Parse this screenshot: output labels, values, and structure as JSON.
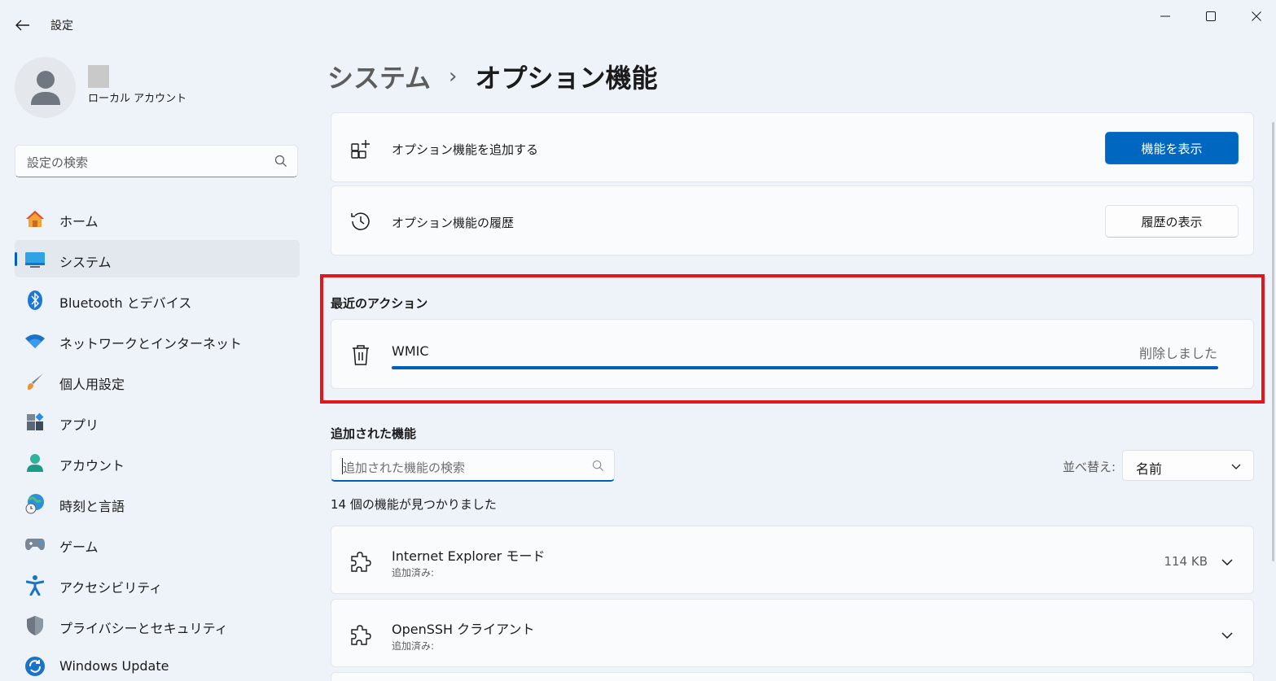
{
  "app": {
    "title": "設定"
  },
  "profile": {
    "account_type": "ローカル アカウント"
  },
  "search": {
    "placeholder": "設定の検索"
  },
  "nav": [
    {
      "label": "ホーム",
      "icon": "home-icon"
    },
    {
      "label": "システム",
      "icon": "monitor-icon",
      "active": true
    },
    {
      "label": "Bluetooth とデバイス",
      "icon": "bluetooth-icon"
    },
    {
      "label": "ネットワークとインターネット",
      "icon": "wifi-icon"
    },
    {
      "label": "個人用設定",
      "icon": "brush-icon"
    },
    {
      "label": "アプリ",
      "icon": "apps-icon"
    },
    {
      "label": "アカウント",
      "icon": "account-icon"
    },
    {
      "label": "時刻と言語",
      "icon": "globe-clock-icon"
    },
    {
      "label": "ゲーム",
      "icon": "gamepad-icon"
    },
    {
      "label": "アクセシビリティ",
      "icon": "accessibility-icon"
    },
    {
      "label": "プライバシーとセキュリティ",
      "icon": "shield-icon"
    },
    {
      "label": "Windows Update",
      "icon": "update-icon"
    }
  ],
  "breadcrumb": {
    "parent": "システム",
    "separator": "›",
    "current": "オプション機能"
  },
  "add_feature": {
    "label": "オプション機能を追加する",
    "button": "機能を表示"
  },
  "history": {
    "label": "オプション機能の履歴",
    "button": "履歴の表示"
  },
  "recent": {
    "title": "最近のアクション",
    "item": {
      "name": "WMIC",
      "status": "削除しました",
      "progress": 1.0
    }
  },
  "installed": {
    "title": "追加された機能",
    "search_placeholder": "追加された機能の検索",
    "sort_label": "並べ替え:",
    "sort_value": "名前",
    "count_text": "14 個の機能が見つかりました",
    "features": [
      {
        "name": "Internet Explorer モード",
        "status": "追加済み:",
        "size": "114 KB"
      },
      {
        "name": "OpenSSH クライアント",
        "status": "追加済み:",
        "size": ""
      }
    ]
  },
  "colors": {
    "accent": "#0067c0",
    "highlight_box": "#e4161c",
    "background": "#eef3f9"
  }
}
